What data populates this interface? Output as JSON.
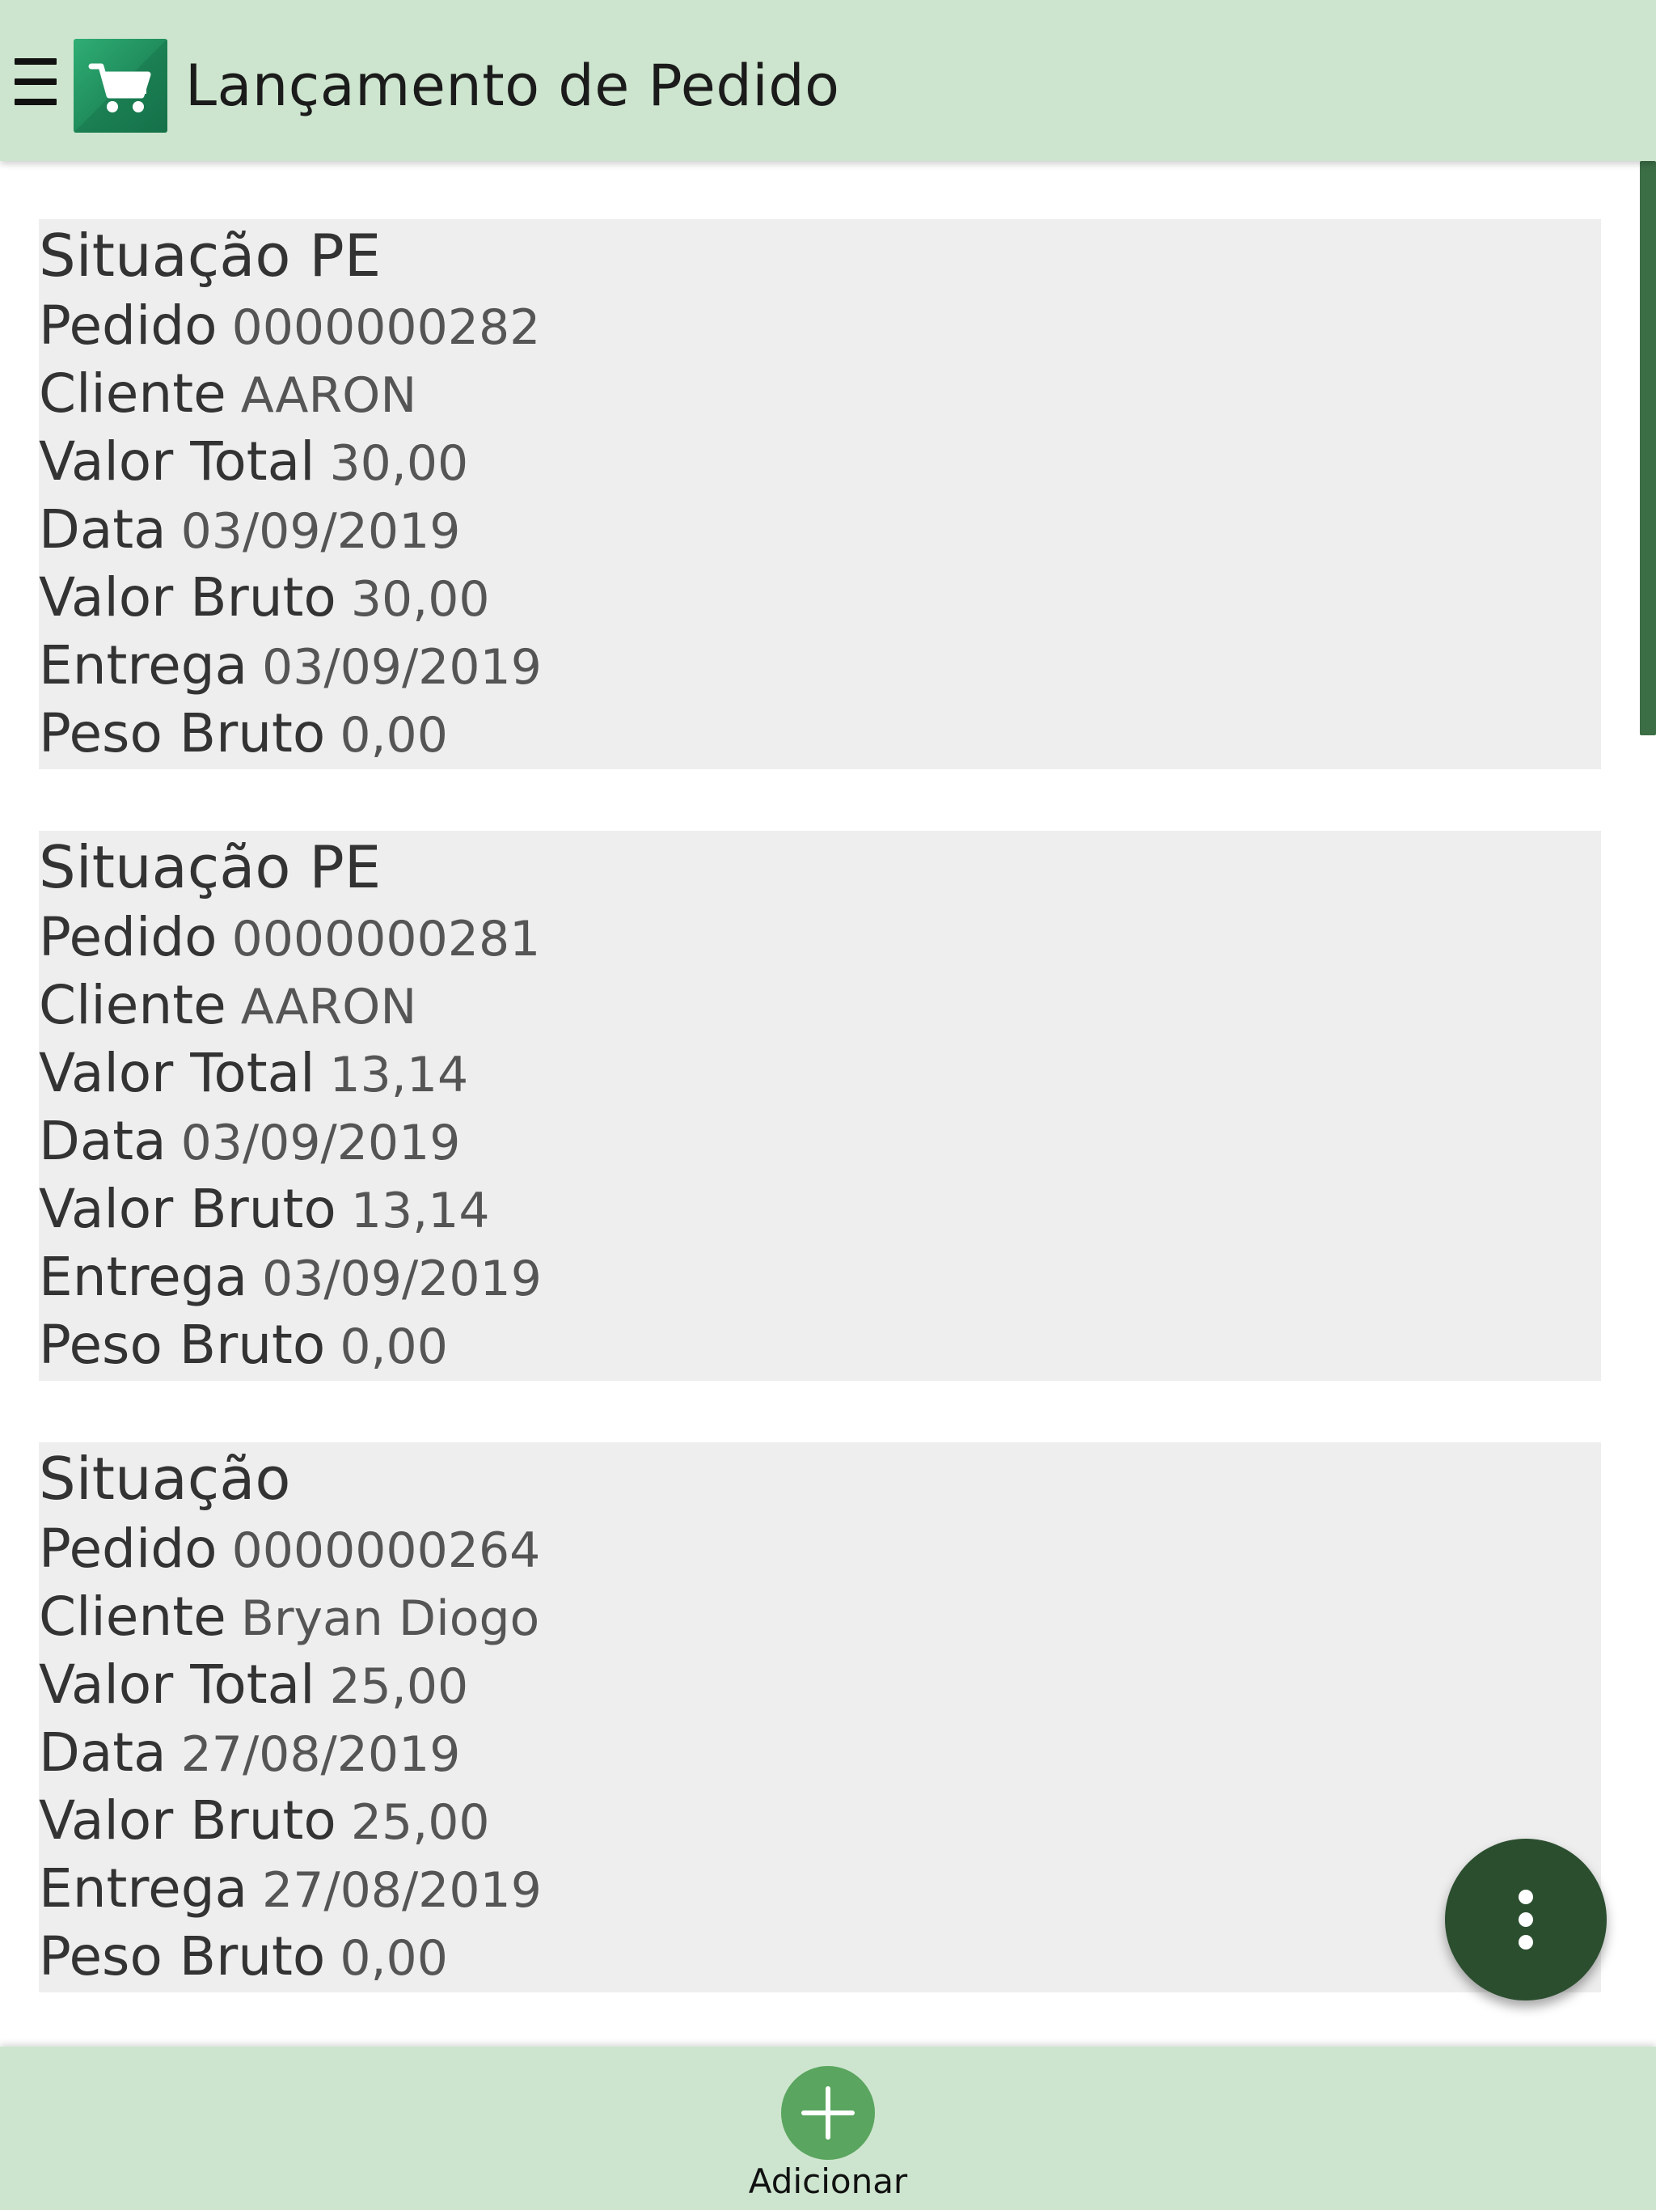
{
  "header": {
    "title": "Lançamento de Pedido"
  },
  "colors": {
    "header_bg": "#cde5ce",
    "card_bg": "#eeeeee",
    "fab_bg": "#2b4e2f",
    "add_bg": "#5aa55f",
    "scrollbar": "#3c6e46"
  },
  "labels": {
    "pedido": "Pedido",
    "cliente": "Cliente",
    "valor_total": "Valor Total",
    "data": "Data",
    "valor_bruto": "Valor Bruto",
    "entrega": "Entrega",
    "peso_bruto": "Peso Bruto"
  },
  "orders": [
    {
      "situacao": "Situação PE",
      "pedido": "0000000282",
      "cliente": "AARON",
      "valor_total": "30,00",
      "data": "03/09/2019",
      "valor_bruto": "30,00",
      "entrega": "03/09/2019",
      "peso_bruto": "0,00"
    },
    {
      "situacao": "Situação PE",
      "pedido": "0000000281",
      "cliente": "AARON",
      "valor_total": "13,14",
      "data": "03/09/2019",
      "valor_bruto": "13,14",
      "entrega": "03/09/2019",
      "peso_bruto": "0,00"
    },
    {
      "situacao": "Situação",
      "pedido": "0000000264",
      "cliente": "Bryan Diogo",
      "valor_total": "25,00",
      "data": "27/08/2019",
      "valor_bruto": "25,00",
      "entrega": "27/08/2019",
      "peso_bruto": "0,00"
    }
  ],
  "bottom_bar": {
    "add_label": "Adicionar"
  },
  "icons": {
    "menu": "hamburger-menu-icon",
    "logo": "shopping-cart-icon",
    "more": "more-vertical-icon",
    "add": "plus-icon"
  }
}
